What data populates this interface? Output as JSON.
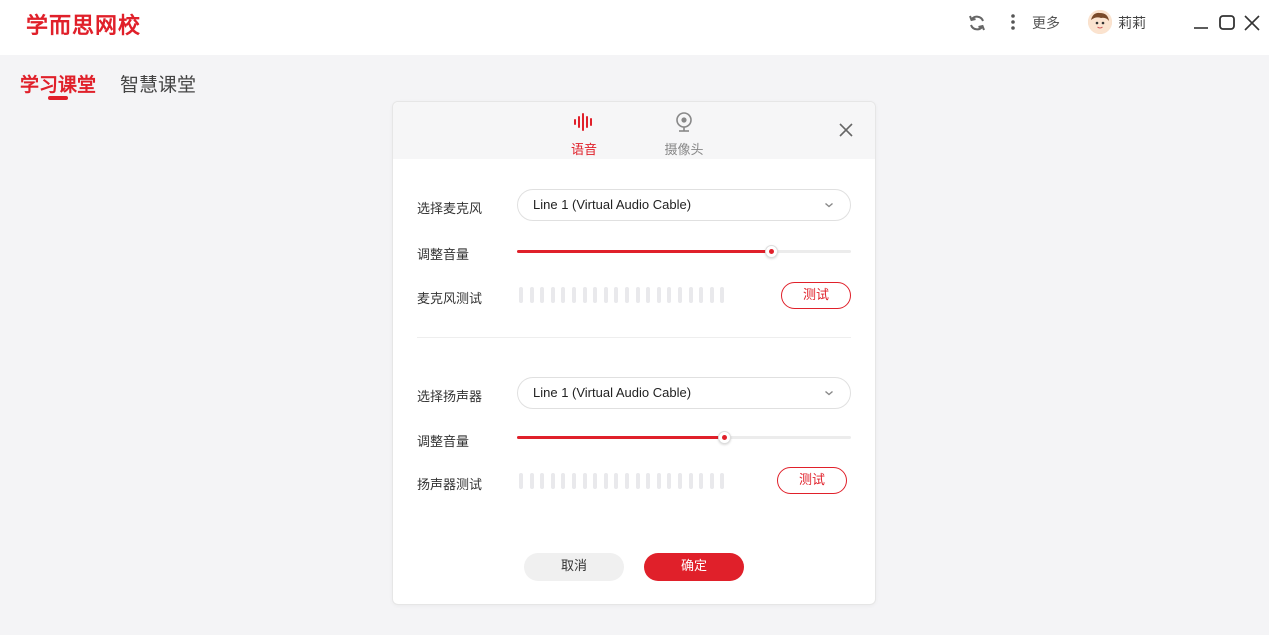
{
  "app": {
    "logo": "学而思网校"
  },
  "titlebar": {
    "more_label": "更多",
    "user_name": "莉莉",
    "icons": [
      "refresh-icon",
      "more-vertical-icon",
      "avatar",
      "minimize-icon",
      "maximize-icon",
      "close-icon"
    ]
  },
  "nav": {
    "tabs": [
      {
        "label": "学习课堂",
        "active": true
      },
      {
        "label": "智慧课堂",
        "active": false
      }
    ]
  },
  "dialog": {
    "tabs": [
      {
        "label": "语音",
        "icon": "sound-wave-icon",
        "active": true
      },
      {
        "label": "摄像头",
        "icon": "webcam-icon",
        "active": false
      }
    ],
    "mic": {
      "select_label": "选择麦克风",
      "device": "Line 1 (Virtual Audio Cable)",
      "volume_label": "调整音量",
      "volume_level": 0.76,
      "test_label": "麦克风测试",
      "test_button": "测试"
    },
    "speaker": {
      "select_label": "选择扬声器",
      "device": "Line 1 (Virtual Audio Cable)",
      "volume_label": "调整音量",
      "volume_level": 0.62,
      "test_label": "扬声器测试",
      "test_button": "测试"
    },
    "cancel_label": "取消",
    "confirm_label": "确定"
  },
  "colors": {
    "accent": "#e0202a",
    "background": "#f4f4f6",
    "inactive_tab": "#888888"
  }
}
